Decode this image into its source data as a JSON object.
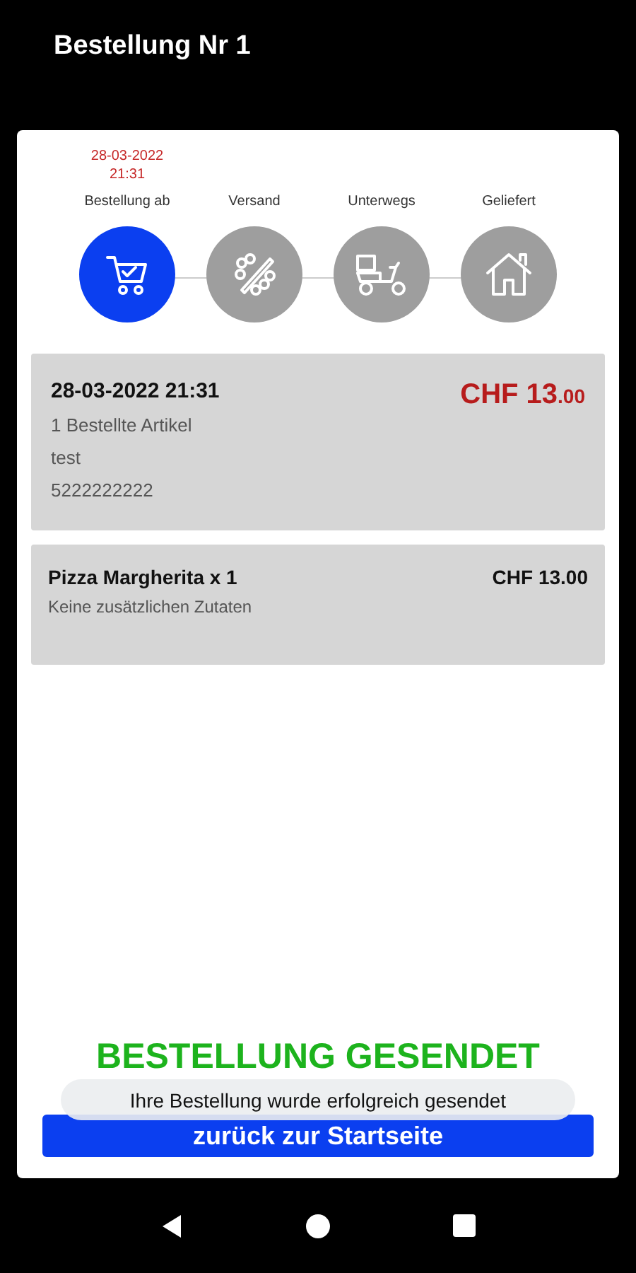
{
  "header": {
    "title": "Bestellung Nr 1"
  },
  "steps": [
    {
      "label": "Bestellung ab",
      "date": "28-03-2022 21:31",
      "selected": true,
      "kind": "cart"
    },
    {
      "label": "Versand",
      "selected": false,
      "kind": "cutter"
    },
    {
      "label": "Unterwegs",
      "selected": false,
      "kind": "scooter"
    },
    {
      "label": "Geliefert",
      "selected": false,
      "kind": "house"
    }
  ],
  "order": {
    "datetime": "28-03-2022 21:31",
    "price_main": "CHF 13",
    "price_cents": ".00",
    "lines": [
      "1 Bestellte Artikel",
      "test",
      "5222222222"
    ]
  },
  "items": [
    {
      "name": "Pizza Margherita x 1",
      "price": "CHF 13.00",
      "note": "Keine zusätzlichen Zutaten"
    }
  ],
  "status_heading": "BESTELLUNG GESENDET",
  "back_button": "zurück zur Startseite",
  "toast": "Ihre Bestellung wurde erfolgreich gesendet"
}
